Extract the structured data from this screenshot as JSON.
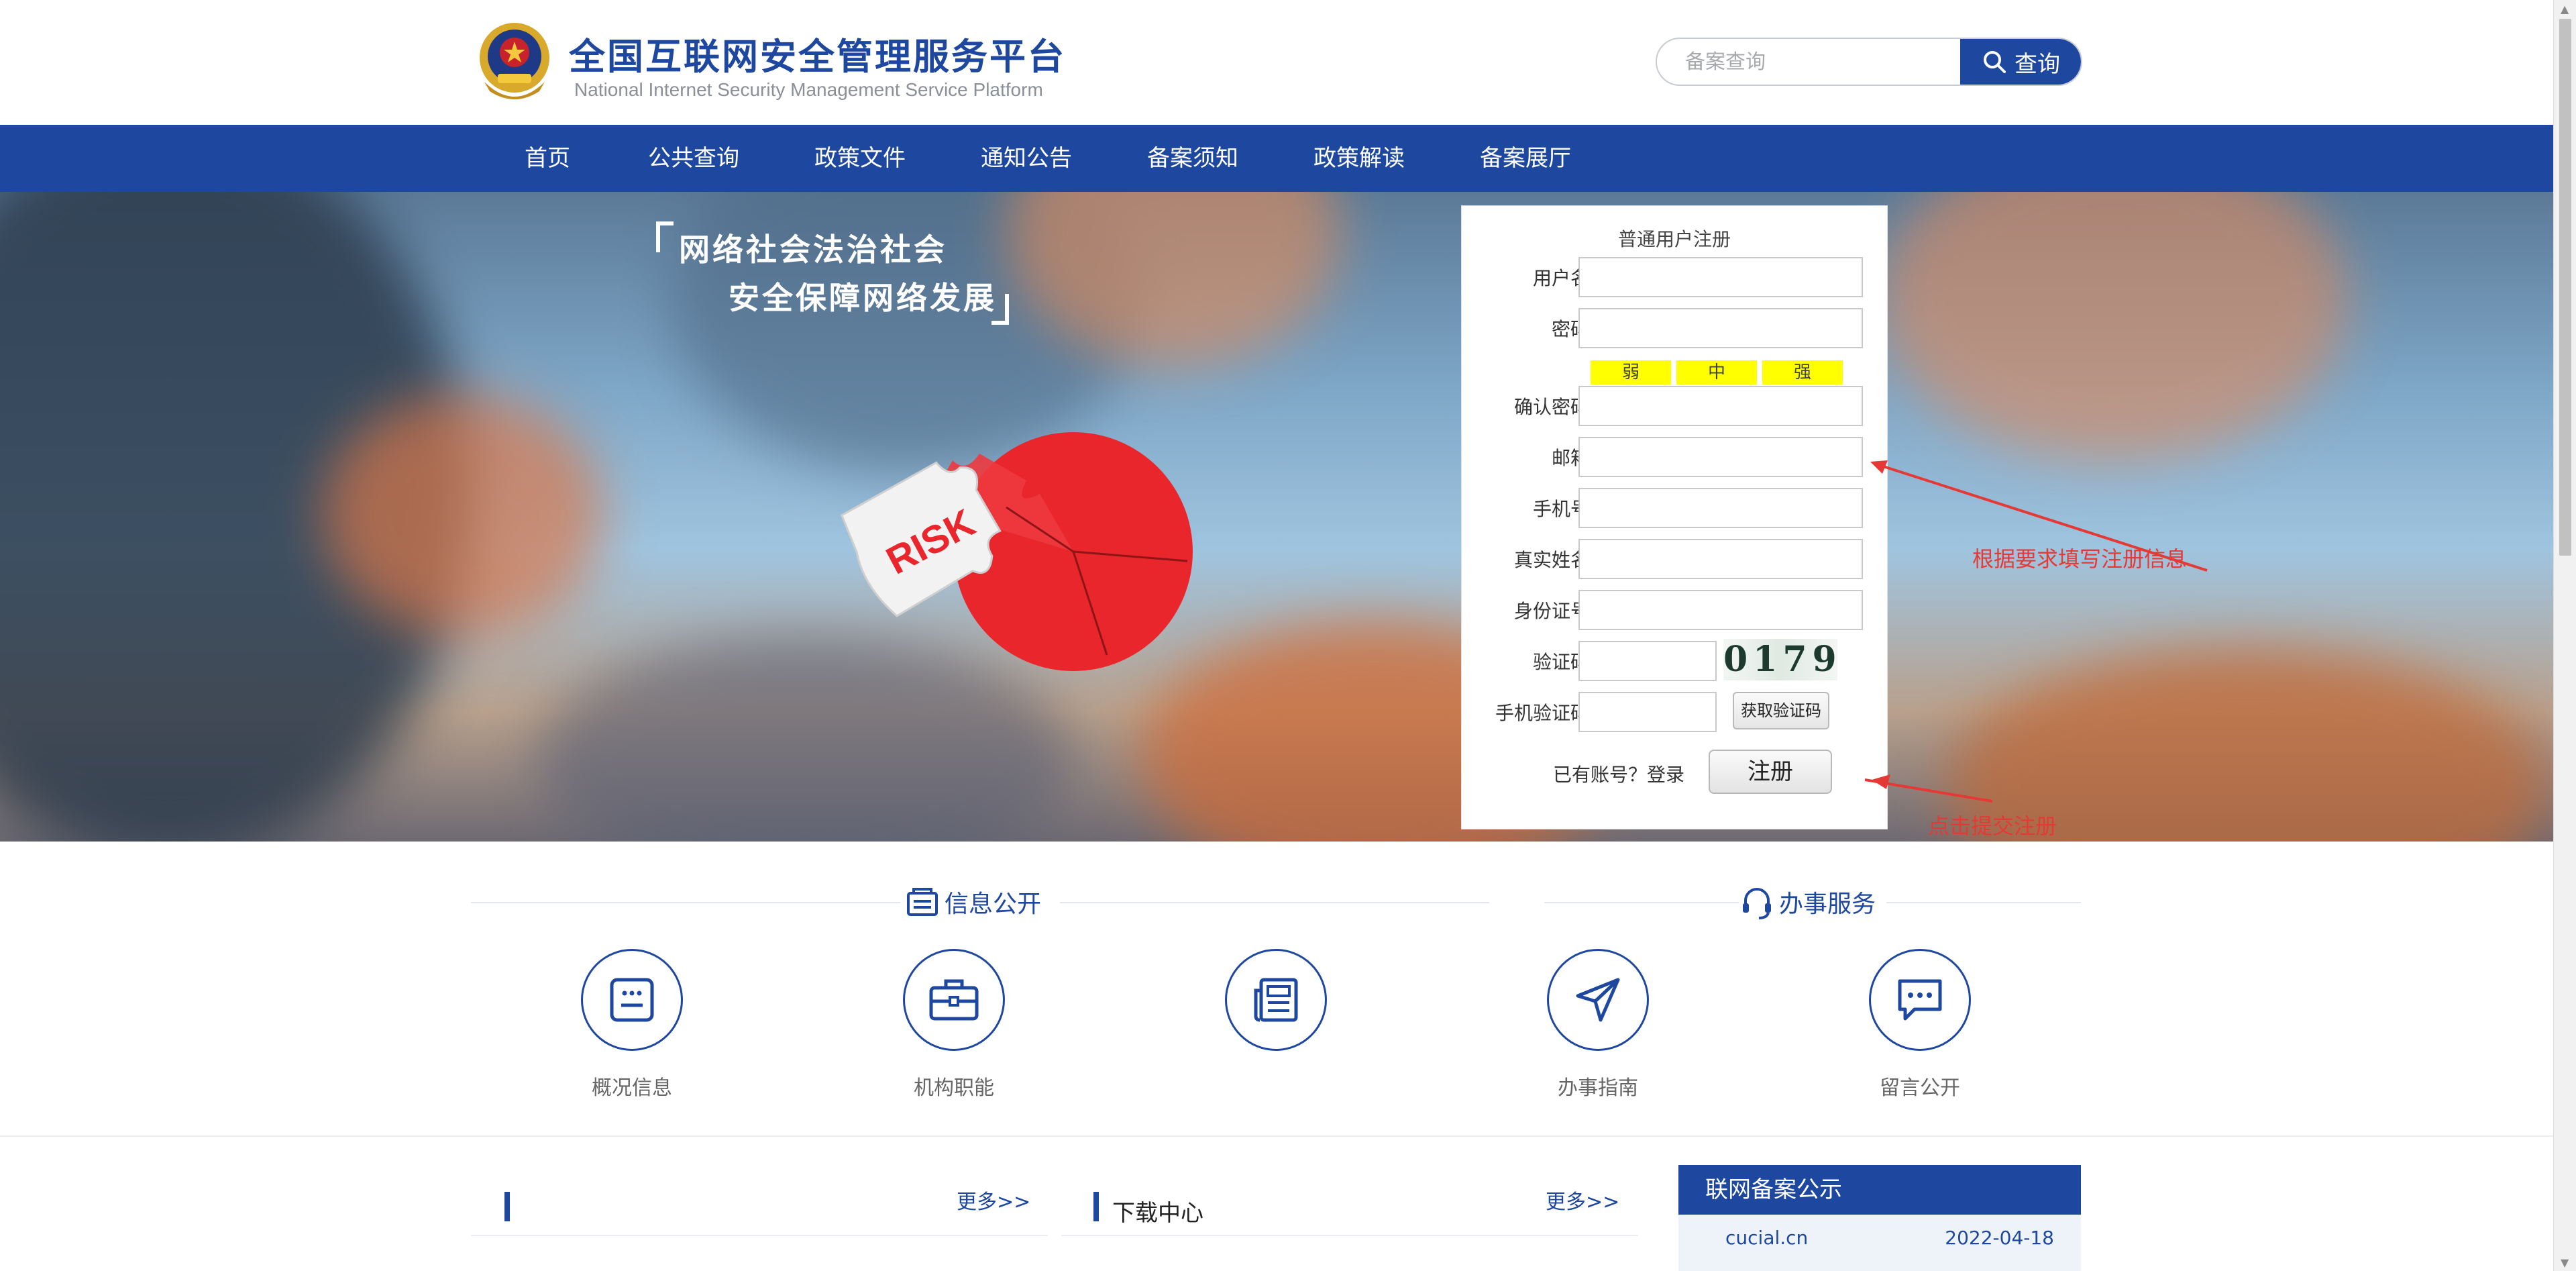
{
  "header": {
    "title_cn": "全国互联网安全管理服务平台",
    "title_en": "National Internet Security Management Service Platform",
    "search_placeholder": "备案查询",
    "search_button": "查询"
  },
  "nav": {
    "items": [
      "首页",
      "公共查询",
      "政策文件",
      "通知公告",
      "备案须知",
      "政策解读",
      "备案展厅"
    ]
  },
  "banner": {
    "slogan_line1": "网络社会法治社会",
    "slogan_line2": "安全保障网络发展",
    "puzzle_text": "RISK"
  },
  "register": {
    "title": "普通用户注册",
    "fields": {
      "username": "用户名",
      "password": "密码",
      "confirm": "确认密码",
      "email": "邮箱",
      "phone": "手机号",
      "realname": "真实姓名",
      "idcard": "身份证号",
      "captcha": "验证码",
      "sms": "手机验证码"
    },
    "strength": [
      "弱",
      "中",
      "强"
    ],
    "captcha_text": "0179",
    "sms_button": "获取验证码",
    "have_account": "已有账号？",
    "login_link": "登录",
    "submit": "注册"
  },
  "annotations": {
    "fill_info": "根据要求填写注册信息",
    "click_submit": "点击提交注册"
  },
  "sections": {
    "info_title": "信息公开",
    "service_title": "办事服务",
    "items": [
      {
        "label": "概况信息",
        "icon": "overview-icon"
      },
      {
        "label": "机构职能",
        "icon": "briefcase-icon"
      },
      {
        "label": "",
        "icon": "newspaper-icon"
      },
      {
        "label": "办事指南",
        "icon": "navigation-icon"
      },
      {
        "label": "留言公开",
        "icon": "message-icon"
      }
    ]
  },
  "panels": {
    "left_title": "",
    "left_more": "更多>>",
    "mid_title": "下载中心",
    "mid_more": "更多>>",
    "beian_title": "联网备案公示",
    "beian_site": "cucial.cn",
    "beian_date": "2022-04-18"
  },
  "colors": {
    "brand": "#1e48a0",
    "annotation": "#e53935",
    "strength_bar": "#ffff00"
  }
}
